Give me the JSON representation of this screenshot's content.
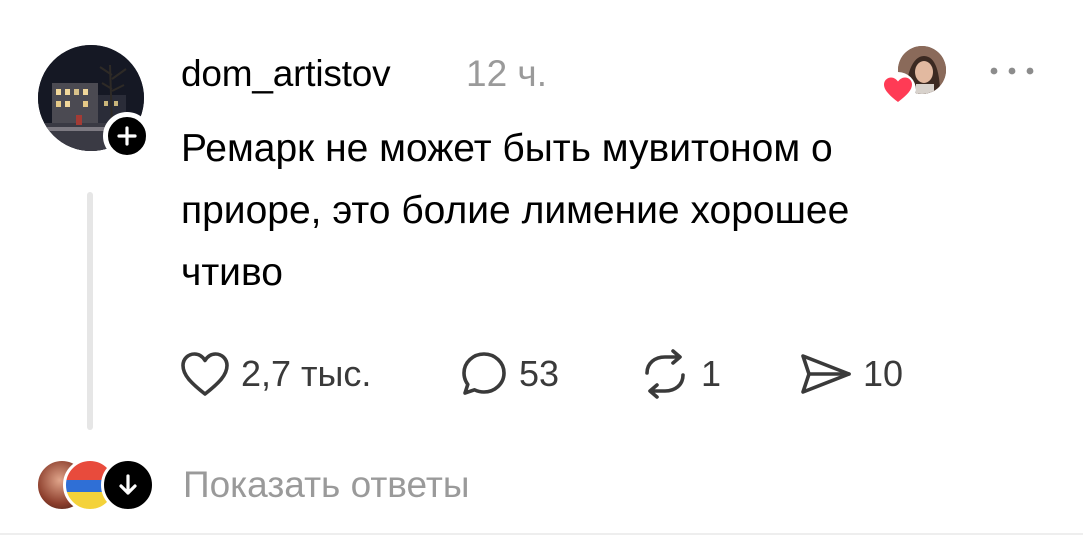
{
  "comment": {
    "username": "dom_artistov",
    "time": "12 ч.",
    "text": "Ремарк не может быть мувитоном о\nприоре, это болие лимение хорошее\nчтиво"
  },
  "actions": {
    "likes": "2,7 тыс.",
    "replies": "53",
    "reposts": "1",
    "shares": "10"
  },
  "footer": {
    "show_replies_label": "Показать ответы"
  },
  "icons": {
    "follow": "plus-icon",
    "like_badge": "heart-icon",
    "more": "more-icon",
    "like": "heart-outline-icon",
    "reply": "comment-bubble-icon",
    "repost": "repost-icon",
    "share": "send-icon",
    "expand": "arrow-down-icon"
  },
  "colors": {
    "heart": "#ff3b55",
    "muted_text": "#9a9a9a",
    "thread_line": "#e6e6e6"
  }
}
